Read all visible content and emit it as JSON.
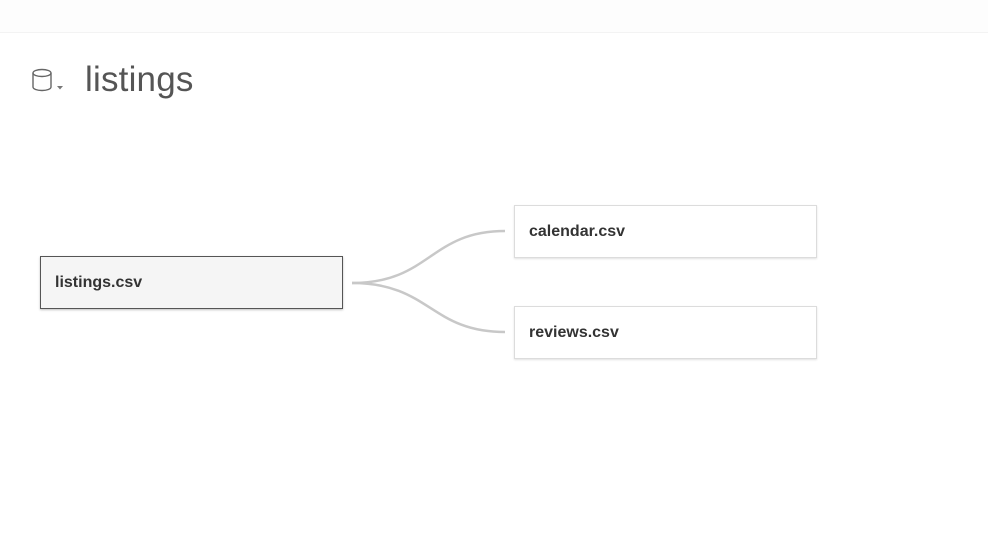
{
  "header": {
    "icon": "database-icon",
    "dropdown_icon": "caret-down-icon",
    "title": "listings"
  },
  "tables": {
    "primary": {
      "label": "listings.csv"
    },
    "related": [
      {
        "label": "calendar.csv"
      },
      {
        "label": "reviews.csv"
      }
    ]
  },
  "colors": {
    "connector": "#c8c8c8",
    "primary_border": "#555555",
    "secondary_border": "#dcdcdc",
    "title_text": "#555555"
  }
}
